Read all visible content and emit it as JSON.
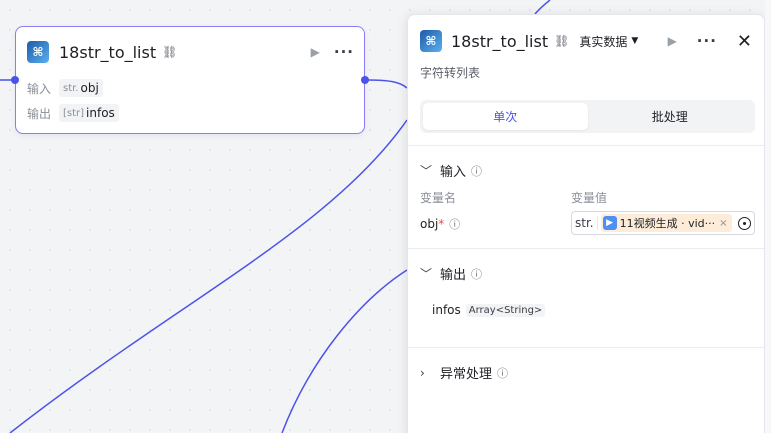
{
  "node": {
    "title": "18str_to_list",
    "title_icon": "link-icon",
    "input_label": "输入",
    "input_type": "str.",
    "input_var": "obj",
    "output_label": "输出",
    "output_type": "[str]",
    "output_var": "infos"
  },
  "panel": {
    "title": "18str_to_list",
    "data_mode": "真实数据",
    "subtitle": "字符转列表",
    "tabs": [
      {
        "label": "单次",
        "active": true
      },
      {
        "label": "批处理",
        "active": false
      }
    ],
    "input_section": {
      "title": "输入",
      "col_name": "变量名",
      "col_value": "变量值",
      "param_name": "obj",
      "required_mark": "*",
      "value_prefix": "str.",
      "ref_text": "11视频生成 · vid···",
      "ref_close": "×"
    },
    "output_section": {
      "title": "输出",
      "var_name": "infos",
      "var_type": "Array<String>"
    },
    "error_section": {
      "title": "异常处理"
    }
  },
  "colors": {
    "accent": "#4d53e8",
    "node_border": "#8b7cf6",
    "ref_bg": "#fdecd8"
  }
}
